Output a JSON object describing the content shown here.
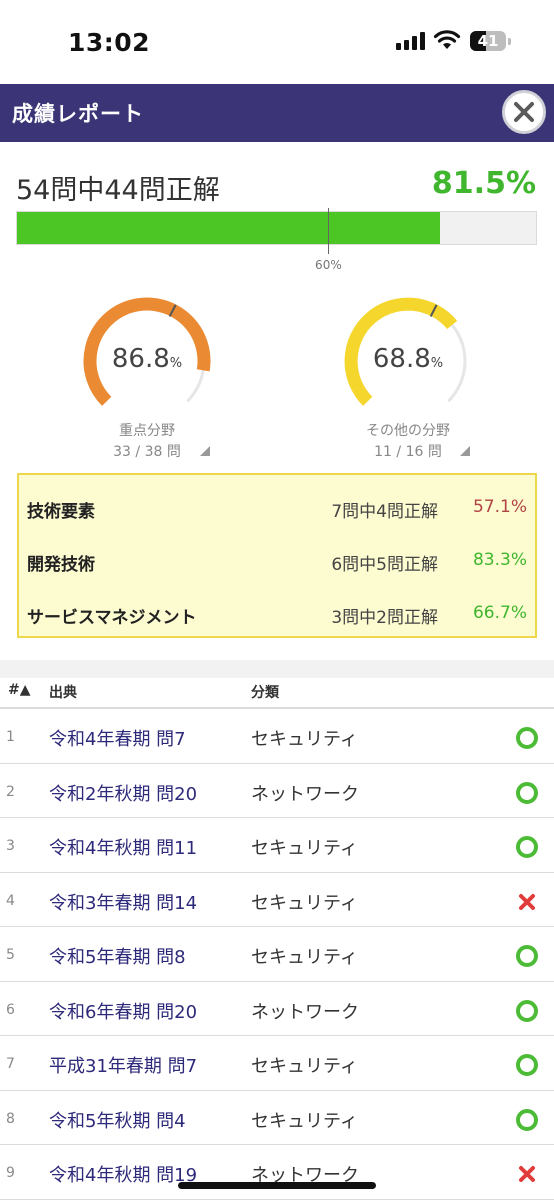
{
  "status_bar": {
    "time": "13:02",
    "battery": "41"
  },
  "header": {
    "title": "成績レポート",
    "close_icon": "close-icon"
  },
  "score": {
    "summary": "54問中44問正解",
    "percent_text": "81.5%",
    "percent_value": 81.5,
    "pass_mark_text": "60%",
    "pass_mark_value": 60,
    "fill_color": "#4cc625"
  },
  "gauges": [
    {
      "value_text": "86.8",
      "unit": "%",
      "value": 86.8,
      "label": "重点分野",
      "count": "33 / 38 問",
      "color": "#ea8a32"
    },
    {
      "value_text": "68.8",
      "unit": "%",
      "value": 68.8,
      "label": "その他の分野",
      "count": "11 / 16 問",
      "color": "#f5d62c"
    }
  ],
  "breakdown": [
    {
      "name": "技術要素",
      "count": "7問中4問正解",
      "rate": "57.1%",
      "color": "#b04343"
    },
    {
      "name": "開発技術",
      "count": "6問中5問正解",
      "rate": "83.3%",
      "color": "#3fb62e"
    },
    {
      "name": "サービスマネジメント",
      "count": "3問中2問正解",
      "rate": "66.7%",
      "color": "#3fb62e"
    }
  ],
  "table": {
    "headers": {
      "num": "#▲",
      "source": "出典",
      "category": "分類"
    },
    "rows": [
      {
        "num": "1",
        "source": "令和4年春期 問7",
        "category": "セキュリティ",
        "correct": true
      },
      {
        "num": "2",
        "source": "令和2年秋期 問20",
        "category": "ネットワーク",
        "correct": true
      },
      {
        "num": "3",
        "source": "令和4年秋期 問11",
        "category": "セキュリティ",
        "correct": true
      },
      {
        "num": "4",
        "source": "令和3年春期 問14",
        "category": "セキュリティ",
        "correct": false
      },
      {
        "num": "5",
        "source": "令和5年春期 問8",
        "category": "セキュリティ",
        "correct": true
      },
      {
        "num": "6",
        "source": "令和6年春期 問20",
        "category": "ネットワーク",
        "correct": true
      },
      {
        "num": "7",
        "source": "平成31年春期 問7",
        "category": "セキュリティ",
        "correct": true
      },
      {
        "num": "8",
        "source": "令和5年秋期 問4",
        "category": "セキュリティ",
        "correct": true
      },
      {
        "num": "9",
        "source": "令和4年秋期 問19",
        "category": "ネットワーク",
        "correct": false
      }
    ]
  }
}
